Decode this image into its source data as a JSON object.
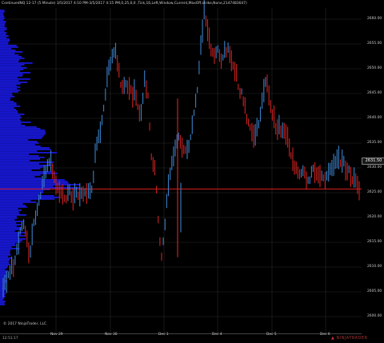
{
  "window": {
    "title": "ContinuedNQ 12-17 (5 Minute) 3/5/2017 4:10 PM-3/5/2017 4:15 PM,0,25,0,0 ,Tick,16,Left,Window,Current,MaxOff,strike,None,2147483647)"
  },
  "footer": {
    "copyright": "© 2017 NinjaTrader, LLC",
    "time": "12:51:17",
    "logo_text": "NINJATRADER"
  },
  "colors": {
    "background": "#000000",
    "grid": "#2a2a2a",
    "up_bar": "#3a80c8",
    "down_bar": "#cc2222",
    "volume_profile": "#1818d8",
    "poc_line": "#ff2222"
  },
  "chart_data": {
    "type": "candlestick",
    "price_axis": {
      "ticks": [
        "2660.00",
        "2655.00",
        "2650.00",
        "2645.00",
        "2640.00",
        "2635.00",
        "2630.00",
        "2625.00",
        "2620.00",
        "2615.00",
        "2610.00",
        "2605.00",
        "2600.00"
      ],
      "last_price": "2631.50",
      "last_price_value": 2631.5
    },
    "time_axis": {
      "ticks": [
        "Nov 29",
        "Nov 30",
        "Dec 1",
        "Dec 4",
        "Dec 5",
        "Dec 6"
      ]
    },
    "volume_profile": {
      "poc_price": 2625.75
    },
    "price_path": [
      [
        0,
        2606
      ],
      [
        2,
        2607
      ],
      [
        4,
        2609
      ],
      [
        6,
        2610
      ],
      [
        8,
        2613
      ],
      [
        10,
        2617
      ],
      [
        11,
        2619
      ],
      [
        12,
        2616
      ],
      [
        13,
        2612
      ],
      [
        14,
        2618
      ],
      [
        15,
        2621
      ],
      [
        16,
        2624
      ],
      [
        17,
        2627
      ],
      [
        18,
        2630
      ],
      [
        19,
        2632
      ],
      [
        20,
        2630
      ],
      [
        21,
        2627
      ],
      [
        22,
        2625
      ],
      [
        23,
        2624
      ],
      [
        24,
        2624
      ],
      [
        25,
        2625
      ],
      [
        26,
        2624
      ],
      [
        27,
        2625
      ],
      [
        28,
        2624
      ],
      [
        29,
        2625
      ],
      [
        30,
        2625
      ],
      [
        31,
        2625
      ],
      [
        32,
        2626
      ],
      [
        33,
        2633
      ],
      [
        34,
        2636
      ],
      [
        35,
        2640
      ],
      [
        36,
        2645
      ],
      [
        37,
        2650
      ],
      [
        38,
        2653
      ],
      [
        39,
        2654
      ],
      [
        40,
        2650
      ],
      [
        41,
        2646
      ],
      [
        42,
        2648
      ],
      [
        43,
        2646
      ],
      [
        44,
        2645
      ],
      [
        45,
        2645
      ],
      [
        46,
        2641
      ],
      [
        47,
        2642
      ],
      [
        48,
        2648
      ],
      [
        49,
        2644
      ],
      [
        50,
        2632
      ],
      [
        51,
        2630
      ],
      [
        52,
        2620
      ],
      [
        53,
        2612
      ],
      [
        54,
        2618
      ],
      [
        55,
        2626
      ],
      [
        56,
        2630
      ],
      [
        57,
        2634
      ],
      [
        58,
        2636
      ],
      [
        59,
        2635
      ],
      [
        60,
        2633
      ],
      [
        61,
        2634
      ],
      [
        62,
        2637
      ],
      [
        63,
        2642
      ],
      [
        64,
        2646
      ],
      [
        65,
        2655
      ],
      [
        66,
        2662
      ],
      [
        67,
        2658
      ],
      [
        68,
        2654
      ],
      [
        69,
        2652
      ],
      [
        70,
        2654
      ],
      [
        71,
        2652
      ],
      [
        72,
        2653
      ],
      [
        73,
        2654
      ],
      [
        74,
        2652
      ],
      [
        75,
        2651
      ],
      [
        76,
        2648
      ],
      [
        77,
        2645
      ],
      [
        78,
        2644
      ],
      [
        79,
        2640
      ],
      [
        80,
        2638
      ],
      [
        81,
        2636
      ],
      [
        82,
        2638
      ],
      [
        83,
        2641
      ],
      [
        84,
        2645
      ],
      [
        85,
        2648
      ],
      [
        86,
        2643
      ],
      [
        87,
        2640
      ],
      [
        88,
        2638
      ],
      [
        89,
        2638
      ],
      [
        90,
        2637
      ],
      [
        91,
        2637
      ],
      [
        92,
        2633
      ],
      [
        93,
        2631
      ],
      [
        94,
        2630
      ],
      [
        95,
        2629
      ],
      [
        96,
        2630
      ],
      [
        97,
        2628
      ],
      [
        98,
        2628
      ],
      [
        99,
        2630
      ],
      [
        100,
        2628
      ],
      [
        101,
        2629
      ],
      [
        102,
        2628
      ],
      [
        103,
        2628
      ],
      [
        104,
        2629
      ],
      [
        105,
        2630
      ],
      [
        106,
        2631
      ],
      [
        107,
        2632
      ],
      [
        108,
        2631
      ]
    ]
  }
}
